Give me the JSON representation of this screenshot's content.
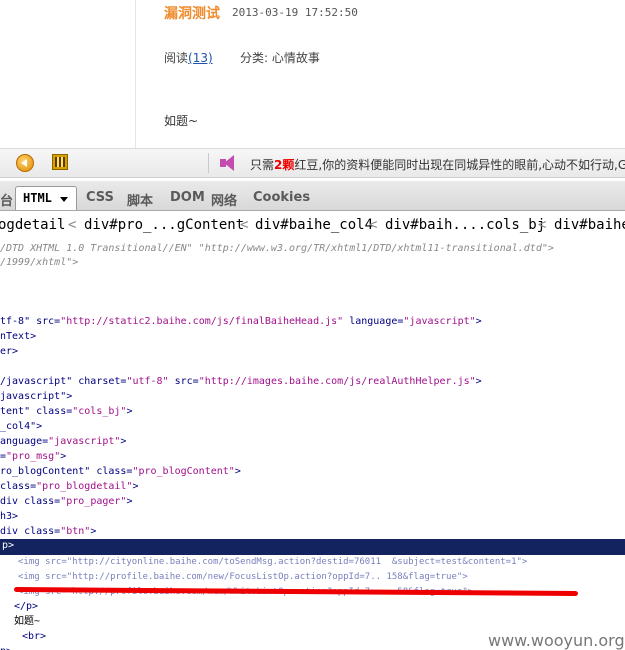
{
  "blog": {
    "post_title": "漏洞测试",
    "post_date": "2013-03-19 17:52:50",
    "read_label": "阅读",
    "read_count": "(13)",
    "category": "分类: 心情故事",
    "body_text": "如题~"
  },
  "message_bar": {
    "prefix": "只需",
    "highlight": "2颗",
    "rest": "红豆,你的资料便能同时出现在同城异性的眼前,心动不如行动,Go"
  },
  "firebug": {
    "tabs": [
      "台",
      "CSS",
      "脚本",
      "DOM",
      "网络",
      "Cookies"
    ],
    "active_tab": "HTML",
    "breadcrumb": [
      "ogdetail",
      "div#pro_...gContent",
      "div#baihe_col4",
      "div#baih....cols_bj",
      "div#baihe"
    ],
    "code_lines": [
      {
        "doctype": "/DTD XHTML 1.0 Transitional//EN\" \"http://www.w3.org/TR/xhtml1/DTD/xhtml11-transitional.dtd\">"
      },
      {
        "doctype": "/1999/xhtml\">"
      },
      {
        "pre": "tf-8\" src=",
        "val": "\"http://static2.baihe.com/js/finalBaiheHead.js\"",
        "post": " language=",
        "val2": "\"javascript\"",
        "end": ">"
      },
      {
        "pre": "nText>"
      },
      {
        "pre": "er>"
      },
      {
        "pre": "/javascript\" charset=",
        "val": "\"utf-8\"",
        "post": " src=",
        "val2": "\"http://images.baihe.com/js/realAuthHelper.js\"",
        "end": ">"
      },
      {
        "pre": "javascript\">"
      },
      {
        "pre": "tent\" class=",
        "val": "\"cols_bj\"",
        "end": ">"
      },
      {
        "pre": "_col4\">"
      },
      {
        "pre": "anguage=",
        "val": "\"javascript\"",
        "end": ">"
      },
      {
        "pre": "=",
        "val": "\"pro_msg\"",
        "end": ">"
      },
      {
        "pre": "ro_blogContent\" class=",
        "val": "\"pro_blogContent\"",
        "end": ">"
      },
      {
        "pre": "class=",
        "val": "\"pro_blogdetail\"",
        "end": ">"
      },
      {
        "pre": "div class=",
        "val": "\"pro_pager\"",
        "end": ">"
      },
      {
        "pre": "h3>"
      },
      {
        "pre": "div class=",
        "val": "\"btn\"",
        "end": ">"
      }
    ],
    "selected_line": "p>",
    "img_lines": [
      "<img src=\"http://cityonline.baihe.com/toSendMsg.action?destid=76011  &subject=test&content=1\">",
      "<img src=\"http://profile.baihe.com/new/FocusListOp.action?oppId=7.. 158&flag=true\">",
      "<img src=\"http://profile.baihe.com/new/WhiteListOp.action?oppId=7 ... 58&flag=true\">"
    ],
    "tail_lines": [
      "</p>",
      "如题~",
      "<br>",
      "p>"
    ]
  },
  "watermark": "www.wooyun.org",
  "colors": {
    "accent": "#f08c2e",
    "selection": "#13235f",
    "underline": "#e00000"
  }
}
